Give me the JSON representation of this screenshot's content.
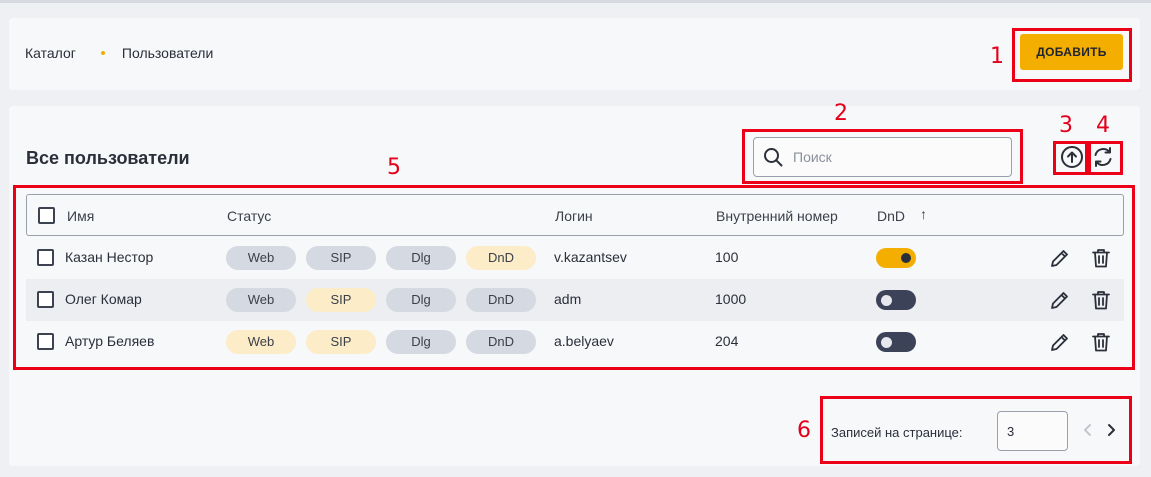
{
  "breadcrumb": {
    "items": [
      "Каталог",
      "Пользователи"
    ]
  },
  "header": {
    "add_button": "ДОБАВИТЬ"
  },
  "main": {
    "title": "Все пользователи",
    "search_placeholder": "Поиск"
  },
  "table": {
    "columns": [
      "Имя",
      "Статус",
      "Логин",
      "Внутренний номер",
      "DnD"
    ],
    "sort_indicator": "↑",
    "rows": [
      {
        "name": "Казан Нестор",
        "chips": [
          "Web",
          "SIP",
          "Dlg",
          "DnD"
        ],
        "chip_active": [
          false,
          false,
          false,
          true
        ],
        "login": "v.kazantsev",
        "ext": "100",
        "dnd": true
      },
      {
        "name": "Олег Комар",
        "chips": [
          "Web",
          "SIP",
          "Dlg",
          "DnD"
        ],
        "chip_active": [
          false,
          true,
          false,
          false
        ],
        "login": "adm",
        "ext": "1000",
        "dnd": false
      },
      {
        "name": "Артур Беляев",
        "chips": [
          "Web",
          "SIP",
          "Dlg",
          "DnD"
        ],
        "chip_active": [
          true,
          true,
          false,
          false
        ],
        "login": "a.belyaev",
        "ext": "204",
        "dnd": false
      }
    ]
  },
  "pagination": {
    "label": "Записей на странице:",
    "value": "3"
  },
  "annotations": [
    "1",
    "2",
    "3",
    "4",
    "5",
    "6"
  ],
  "colors": {
    "accent": "#f4ae00",
    "annotation": "#ec0017",
    "toggle_off": "#3c4358"
  }
}
